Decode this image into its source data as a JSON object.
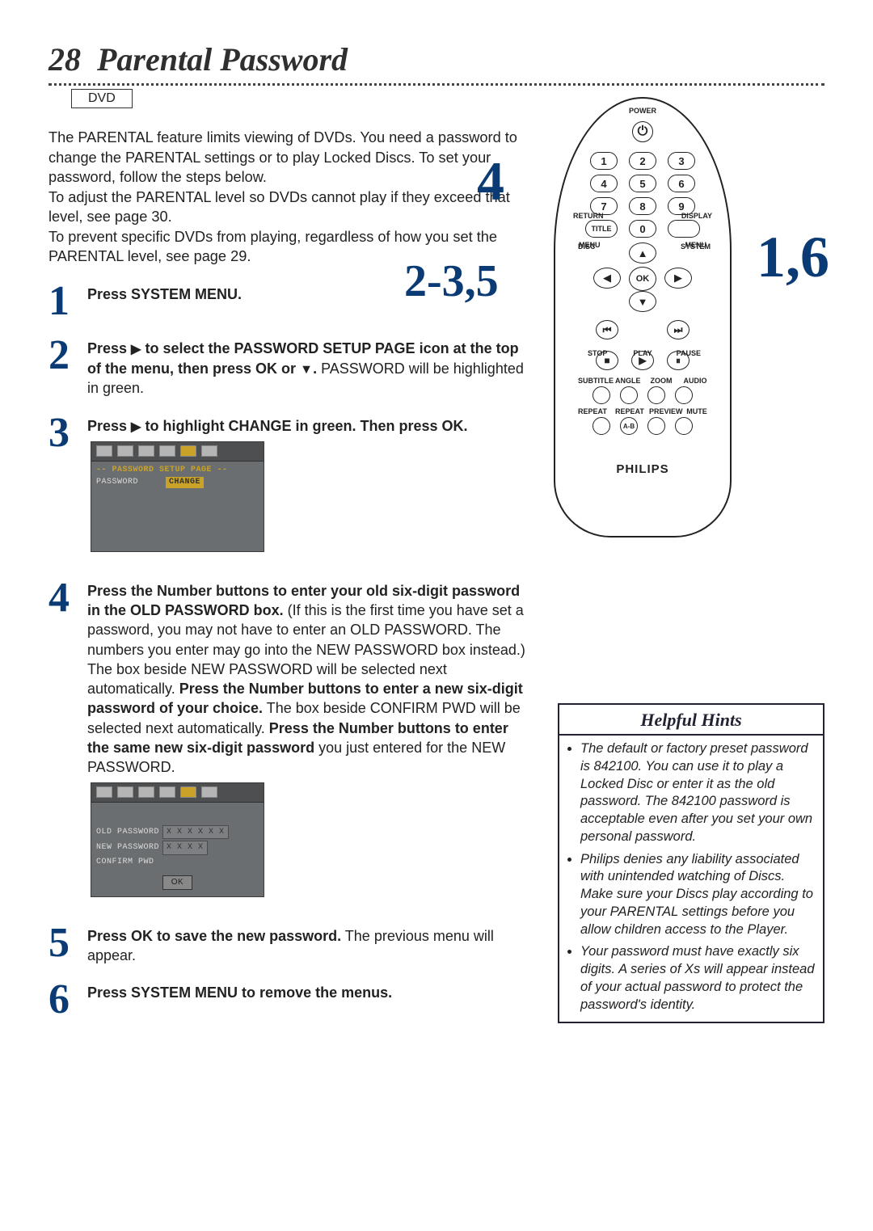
{
  "heading": {
    "page_no": "28",
    "title": "Parental Password"
  },
  "badge": "DVD",
  "intro": {
    "p1": "The PARENTAL feature limits viewing of DVDs. You need a password to change the PARENTAL settings or to play Locked Discs. To set your password, follow the steps below.",
    "p2": "To adjust the PARENTAL level so DVDs cannot play if they exceed that level, see page 30.",
    "p3": "To prevent specific DVDs from playing, regardless of how you set the PARENTAL level, see page 29."
  },
  "steps": {
    "s1": {
      "n": "1",
      "bold": "Press SYSTEM MENU."
    },
    "s2": {
      "n": "2",
      "bold_a": "Press ",
      "bold_b": " to select the PASSWORD SETUP PAGE icon at the top of the menu, then press OK or ",
      "bold_c": ".",
      "tail": " PASSWORD will be highlighted in green."
    },
    "s3": {
      "n": "3",
      "bold_a": "Press ",
      "bold_b": " to highlight CHANGE in green. Then press OK."
    },
    "s4": {
      "n": "4",
      "bold1": "Press the Number buttons to enter your old six-digit password in the OLD PASSWORD box.",
      "mid1": " (If this is the first time you have set a password, you may not have to enter an OLD PASSWORD. The numbers you enter may go into the NEW PASSWORD box instead.) The box beside NEW PASSWORD will be selected next automatically. ",
      "bold2": "Press the Number buttons to enter a new six-digit password of your choice.",
      "mid2": " The box beside CONFIRM PWD will be selected next automatically. ",
      "bold3": "Press the Number buttons to enter the same new six-digit password",
      "mid3": " you just entered for the NEW PASSWORD."
    },
    "s5": {
      "n": "5",
      "bold": "Press OK to save the new password.",
      "tail": "  The previous menu will appear."
    },
    "s6": {
      "n": "6",
      "bold": "Press SYSTEM MENU to remove the menus."
    }
  },
  "osd1": {
    "title": "-- PASSWORD SETUP PAGE --",
    "row_label": "PASSWORD",
    "row_value": "CHANGE"
  },
  "osd2": {
    "old": "OLD PASSWORD",
    "new": "NEW PASSWORD",
    "confirm": "CONFIRM PWD",
    "old_v": "X X X X X X",
    "new_v": "X X X X",
    "ok": "OK"
  },
  "callouts": {
    "a": "4",
    "b": "2-3,5",
    "c": "1,6"
  },
  "remote": {
    "power": "POWER",
    "nums": [
      "1",
      "2",
      "3",
      "4",
      "5",
      "6",
      "7",
      "8",
      "9",
      "0"
    ],
    "return": "RETURN",
    "display": "DISPLAY",
    "title": "TITLE",
    "disc_menu": "DISC",
    "menu_l": "MENU",
    "system": "SYSTEM",
    "menu_r": "MENU",
    "ok": "OK",
    "stop": "STOP",
    "play": "PLAY",
    "pause": "PAUSE",
    "row1": [
      "SUBTITLE",
      "ANGLE",
      "ZOOM",
      "AUDIO"
    ],
    "row2": [
      "REPEAT",
      "REPEAT",
      "PREVIEW",
      "MUTE"
    ],
    "ab": "A-B",
    "brand": "PHILIPS"
  },
  "hints": {
    "title": "Helpful Hints",
    "items": [
      "The default or factory preset password is 842100. You can use it to play a Locked Disc or enter it as the old password. The 842100 password is acceptable even after you set your own personal password.",
      "Philips denies any liability associated with unintended watching of Discs. Make sure your Discs play according to your PARENTAL settings before you allow children access to the Player.",
      "Your password must have exactly six digits. A series of Xs will appear instead of your actual password to protect the password's identity."
    ]
  }
}
